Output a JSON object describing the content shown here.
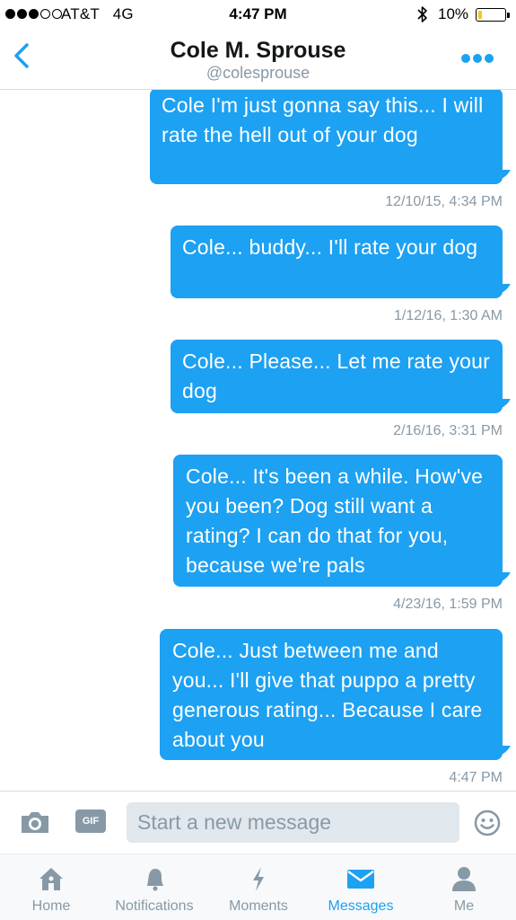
{
  "status_bar": {
    "carrier": "AT&T",
    "network": "4G",
    "time": "4:47 PM",
    "battery": "10%",
    "battery_level": 0.1
  },
  "header": {
    "name": "Cole M. Sprouse",
    "handle": "@colesprouse"
  },
  "messages": [
    {
      "text": "Cole I'm just gonna say this... I will rate the hell out of your dog",
      "time": "12/10/15, 4:34 PM"
    },
    {
      "text": "Cole... buddy... I'll rate your dog",
      "time": "1/12/16, 1:30 AM"
    },
    {
      "text": "Cole... Please... Let me rate your dog",
      "time": "2/16/16, 3:31 PM"
    },
    {
      "text": "Cole... It's been a while. How've you been? Dog still want a rating? I can do that for you, because we're pals",
      "time": "4/23/16, 1:59 PM"
    },
    {
      "text": "Cole... Just between me and you... I'll give that puppo a pretty generous rating... Because I care about you",
      "time": "4:47 PM"
    }
  ],
  "composer": {
    "gif_label": "GIF",
    "placeholder": "Start a new message"
  },
  "tabs": [
    {
      "label": "Home"
    },
    {
      "label": "Notifications"
    },
    {
      "label": "Moments"
    },
    {
      "label": "Messages"
    },
    {
      "label": "Me"
    }
  ],
  "colors": {
    "accent": "#1da1f2",
    "muted": "#8899a6",
    "battery": "#f4c721"
  }
}
